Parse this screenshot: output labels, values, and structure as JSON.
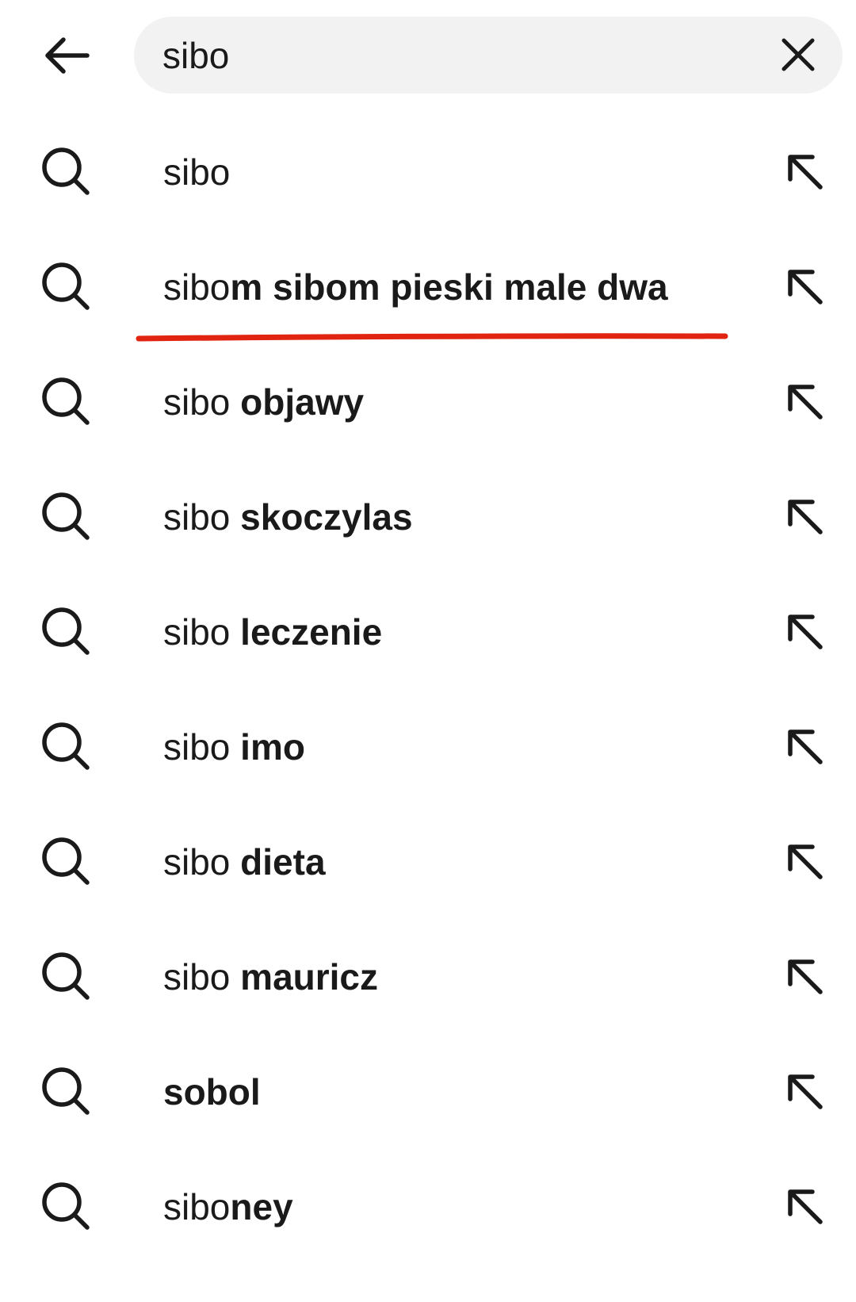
{
  "header": {
    "back_icon": "arrow-left-icon",
    "search": {
      "value": "sibo",
      "placeholder": ""
    },
    "clear_icon": "close-icon"
  },
  "suggestions": [
    {
      "typed": "sibo",
      "rest": "",
      "icon": "search-icon",
      "action_icon": "arrow-up-left-icon"
    },
    {
      "typed": "sibo",
      "rest": "m sibom pieski male dwa",
      "icon": "search-icon",
      "action_icon": "arrow-up-left-icon"
    },
    {
      "typed": "sibo ",
      "rest": "objawy",
      "icon": "search-icon",
      "action_icon": "arrow-up-left-icon"
    },
    {
      "typed": "sibo ",
      "rest": "skoczylas",
      "icon": "search-icon",
      "action_icon": "arrow-up-left-icon"
    },
    {
      "typed": "sibo ",
      "rest": "leczenie",
      "icon": "search-icon",
      "action_icon": "arrow-up-left-icon"
    },
    {
      "typed": "sibo ",
      "rest": "imo",
      "icon": "search-icon",
      "action_icon": "arrow-up-left-icon"
    },
    {
      "typed": "sibo ",
      "rest": "dieta",
      "icon": "search-icon",
      "action_icon": "arrow-up-left-icon"
    },
    {
      "typed": "sibo ",
      "rest": "mauricz",
      "icon": "search-icon",
      "action_icon": "arrow-up-left-icon"
    },
    {
      "typed": "",
      "rest": "sobol",
      "icon": "search-icon",
      "action_icon": "arrow-up-left-icon"
    },
    {
      "typed": "sibo",
      "rest": "ney",
      "icon": "search-icon",
      "action_icon": "arrow-up-left-icon"
    }
  ],
  "annotation": {
    "color": "#e0240f",
    "target_row": 2
  },
  "colors": {
    "text": "#1a1a1a",
    "search_bg": "#f2f2f2",
    "annotation": "#e0240f"
  }
}
